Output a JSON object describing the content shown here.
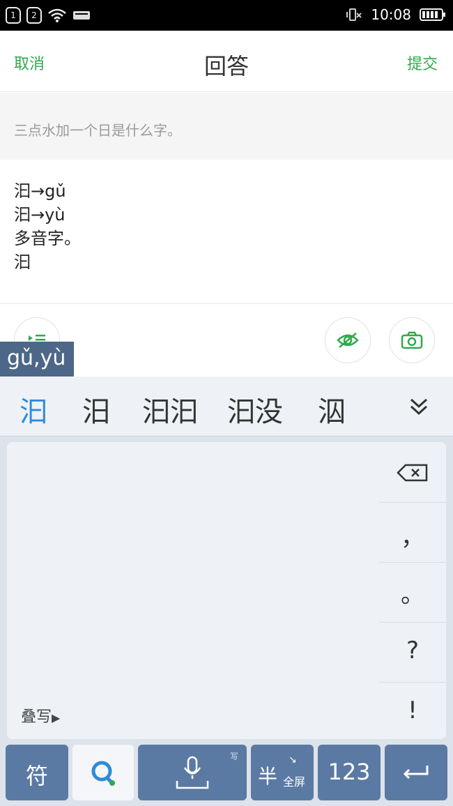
{
  "status": {
    "time": "10:08",
    "sim1": "1",
    "sim2": "2"
  },
  "header": {
    "cancel": "取消",
    "title": "回答",
    "submit": "提交"
  },
  "question": {
    "text": "三点水加一个日是什么字。"
  },
  "answer": {
    "lines": [
      "汩→gǔ",
      "汩→yù",
      "多音字。",
      "汩"
    ]
  },
  "composing": {
    "pinyin": "gǔ,yù"
  },
  "candidates": [
    "汩",
    "汨",
    "汩汩",
    "汩没",
    "泅"
  ],
  "handwriting": {
    "label": "叠写",
    "side_keys": [
      "，",
      "。",
      "?",
      "!"
    ]
  },
  "bottom_row": {
    "symbol": "符",
    "half": "半",
    "full": "全屏",
    "numbers": "123",
    "voice_hint": "写"
  },
  "colors": {
    "accent_green": "#2eaa4c",
    "key_blue": "#5b7aa3",
    "candidate_active": "#2f8bd8"
  },
  "icons": {
    "list": "list-icon",
    "hide": "eye-hidden-icon",
    "camera": "camera-icon",
    "expand": "double-chevron-down-icon",
    "backspace": "backspace-icon",
    "mic": "microphone-icon",
    "enter": "enter-icon",
    "app": "q-logo-icon"
  }
}
